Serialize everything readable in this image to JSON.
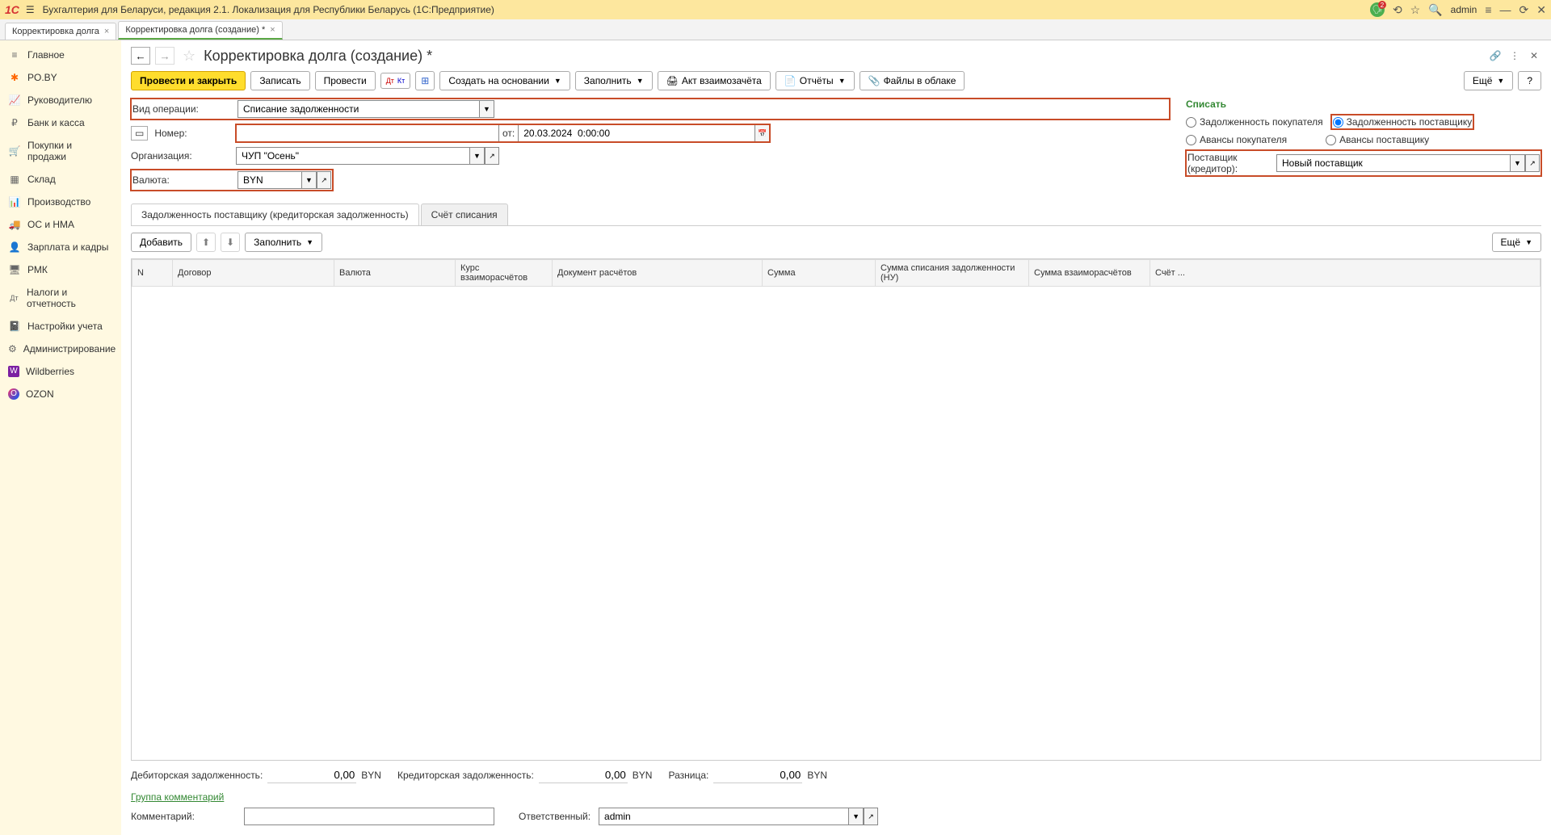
{
  "titlebar": {
    "logo": "1С",
    "title": "Бухгалтерия для Беларуси, редакция 2.1. Локализация для Республики Беларусь   (1С:Предприятие)",
    "user": "admin",
    "notif_count": "2"
  },
  "tabs": [
    {
      "label": "Корректировка долга"
    },
    {
      "label": "Корректировка долга (создание) *"
    }
  ],
  "sidebar": [
    {
      "icon": "≡",
      "label": "Главное"
    },
    {
      "icon": "✱",
      "label": "PO.BY",
      "color": "#ff6600"
    },
    {
      "icon": "📈",
      "label": "Руководителю"
    },
    {
      "icon": "₽",
      "label": "Банк и касса"
    },
    {
      "icon": "🛒",
      "label": "Покупки и продажи"
    },
    {
      "icon": "▦",
      "label": "Склад"
    },
    {
      "icon": "📊",
      "label": "Производство"
    },
    {
      "icon": "🚚",
      "label": "ОС и НМА"
    },
    {
      "icon": "👤",
      "label": "Зарплата и кадры"
    },
    {
      "icon": "🖥",
      "label": "РМК"
    },
    {
      "icon": "Дт",
      "label": "Налоги и отчетность"
    },
    {
      "icon": "📓",
      "label": "Настройки учета"
    },
    {
      "icon": "⚙",
      "label": "Администрирование"
    },
    {
      "icon": "W",
      "label": "Wildberries",
      "bg": "#7b1fa2"
    },
    {
      "icon": "O",
      "label": "OZON",
      "bg": "#005bff"
    }
  ],
  "page": {
    "title": "Корректировка долга (создание) *"
  },
  "toolbar": {
    "post_close": "Провести и закрыть",
    "save": "Записать",
    "post": "Провести",
    "create_based": "Создать на основании",
    "fill": "Заполнить",
    "act": "Акт взаимозачёта",
    "reports": "Отчёты",
    "files": "Файлы в облаке",
    "more": "Ещё"
  },
  "form": {
    "operation_label": "Вид операции:",
    "operation_value": "Списание задолженности",
    "number_label": "Номер:",
    "number_value": "",
    "date_label": "от:",
    "date_value": "20.03.2024  0:00:00",
    "org_label": "Организация:",
    "org_value": "ЧУП \"Осень\"",
    "currency_label": "Валюта:",
    "currency_value": "BYN",
    "writeoff_title": "Списать",
    "radio1": "Задолженность покупателя",
    "radio2": "Задолженность поставщику",
    "radio3": "Авансы покупателя",
    "radio4": "Авансы поставщику",
    "supplier_label": "Поставщик (кредитор):",
    "supplier_value": "Новый поставщик"
  },
  "tabs2": {
    "tab1": "Задолженность поставщику (кредиторская задолженность)",
    "tab2": "Счёт списания"
  },
  "subtoolbar": {
    "add": "Добавить",
    "fill": "Заполнить",
    "more": "Ещё"
  },
  "table_headers": [
    "N",
    "Договор",
    "Валюта",
    "Курс взаиморасчётов",
    "Документ расчётов",
    "Сумма",
    "Сумма списания задолженности (НУ)",
    "Сумма взаиморасчётов",
    "Счёт ..."
  ],
  "bottom": {
    "debit_label": "Дебиторская задолженность:",
    "debit_value": "0,00",
    "debit_cur": "BYN",
    "credit_label": "Кредиторская задолженность:",
    "credit_value": "0,00",
    "credit_cur": "BYN",
    "diff_label": "Разница:",
    "diff_value": "0,00",
    "diff_cur": "BYN",
    "comment_group": "Группа комментарий",
    "comment_label": "Комментарий:",
    "comment_value": "",
    "resp_label": "Ответственный:",
    "resp_value": "admin"
  }
}
